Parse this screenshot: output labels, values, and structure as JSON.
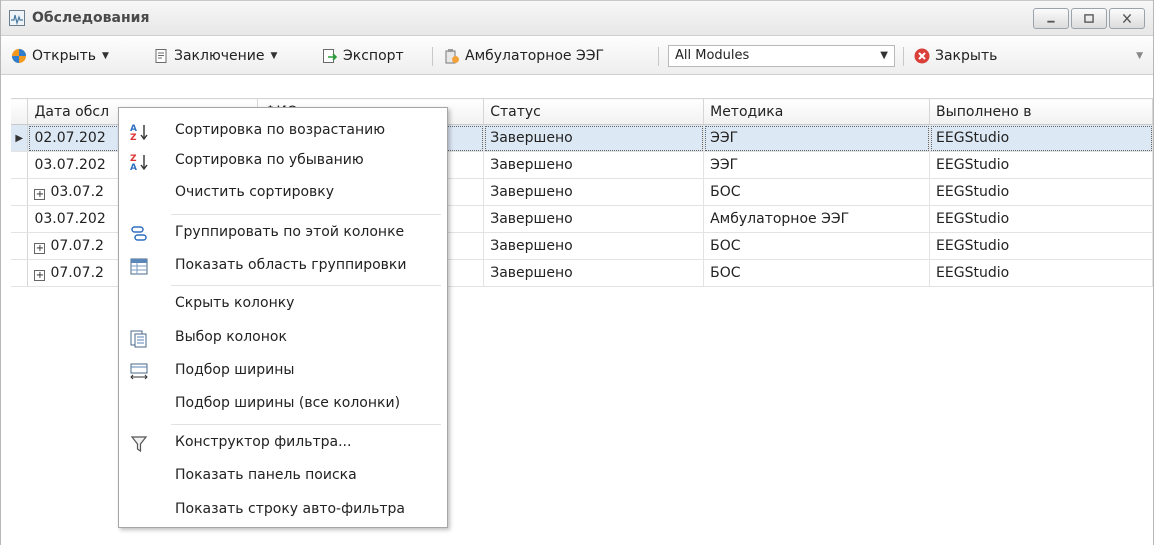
{
  "window": {
    "title": "Обследования"
  },
  "toolbar": {
    "open_label": "Открыть",
    "conclusion_label": "Заключение",
    "export_label": "Экспорт",
    "ambulatory_label": "Амбулаторное ЭЭГ",
    "modules_value": "All Modules",
    "close_label": "Закрыть"
  },
  "grid": {
    "columns": [
      "Дата обсл",
      "ФИО",
      "Статус",
      "Методика",
      "Выполнено в"
    ],
    "rows": [
      {
        "date": "02.07.202",
        "status": "Завершено",
        "method": "ЭЭГ",
        "done_in": "EEGStudio",
        "expandable": false,
        "selected": true
      },
      {
        "date": "03.07.202",
        "status": "Завершено",
        "method": "ЭЭГ",
        "done_in": "EEGStudio",
        "expandable": false,
        "selected": false
      },
      {
        "date": "03.07.2",
        "status": "Завершено",
        "method": "БОС",
        "done_in": "EEGStudio",
        "expandable": true,
        "selected": false
      },
      {
        "date": "03.07.202",
        "status": "Завершено",
        "method": "Амбулаторное ЭЭГ",
        "done_in": "EEGStudio",
        "expandable": false,
        "selected": false
      },
      {
        "date": "07.07.2",
        "status": "Завершено",
        "method": "БОС",
        "done_in": "EEGStudio",
        "expandable": true,
        "selected": false
      },
      {
        "date": "07.07.2",
        "status": "Завершено",
        "method": "БОС",
        "done_in": "EEGStudio",
        "expandable": true,
        "selected": false
      }
    ]
  },
  "context_menu": {
    "items": [
      {
        "label": "Сортировка по возрастанию",
        "icon": "sort-ascending-icon"
      },
      {
        "label": "Сортировка по убыванию",
        "icon": "sort-descending-icon"
      },
      {
        "label": "Очистить сортировку",
        "icon": ""
      },
      {
        "label": "Группировать по этой колонке",
        "icon": "group-by-column-icon"
      },
      {
        "label": "Показать область группировки",
        "icon": "group-panel-icon"
      },
      {
        "label": "Скрыть колонку",
        "icon": ""
      },
      {
        "label": "Выбор колонок",
        "icon": "column-chooser-icon"
      },
      {
        "label": "Подбор ширины",
        "icon": "best-fit-icon"
      },
      {
        "label": "Подбор ширины (все колонки)",
        "icon": ""
      },
      {
        "label": "Конструктор фильтра...",
        "icon": "filter-icon"
      },
      {
        "label": "Показать панель поиска",
        "icon": ""
      },
      {
        "label": "Показать строку авто-фильтра",
        "icon": ""
      }
    ]
  },
  "colors": {
    "selection": "#dde8f5",
    "close_red": "#d9403a",
    "open_orange": "#f39a1e",
    "open_blue": "#2f7fd0"
  }
}
